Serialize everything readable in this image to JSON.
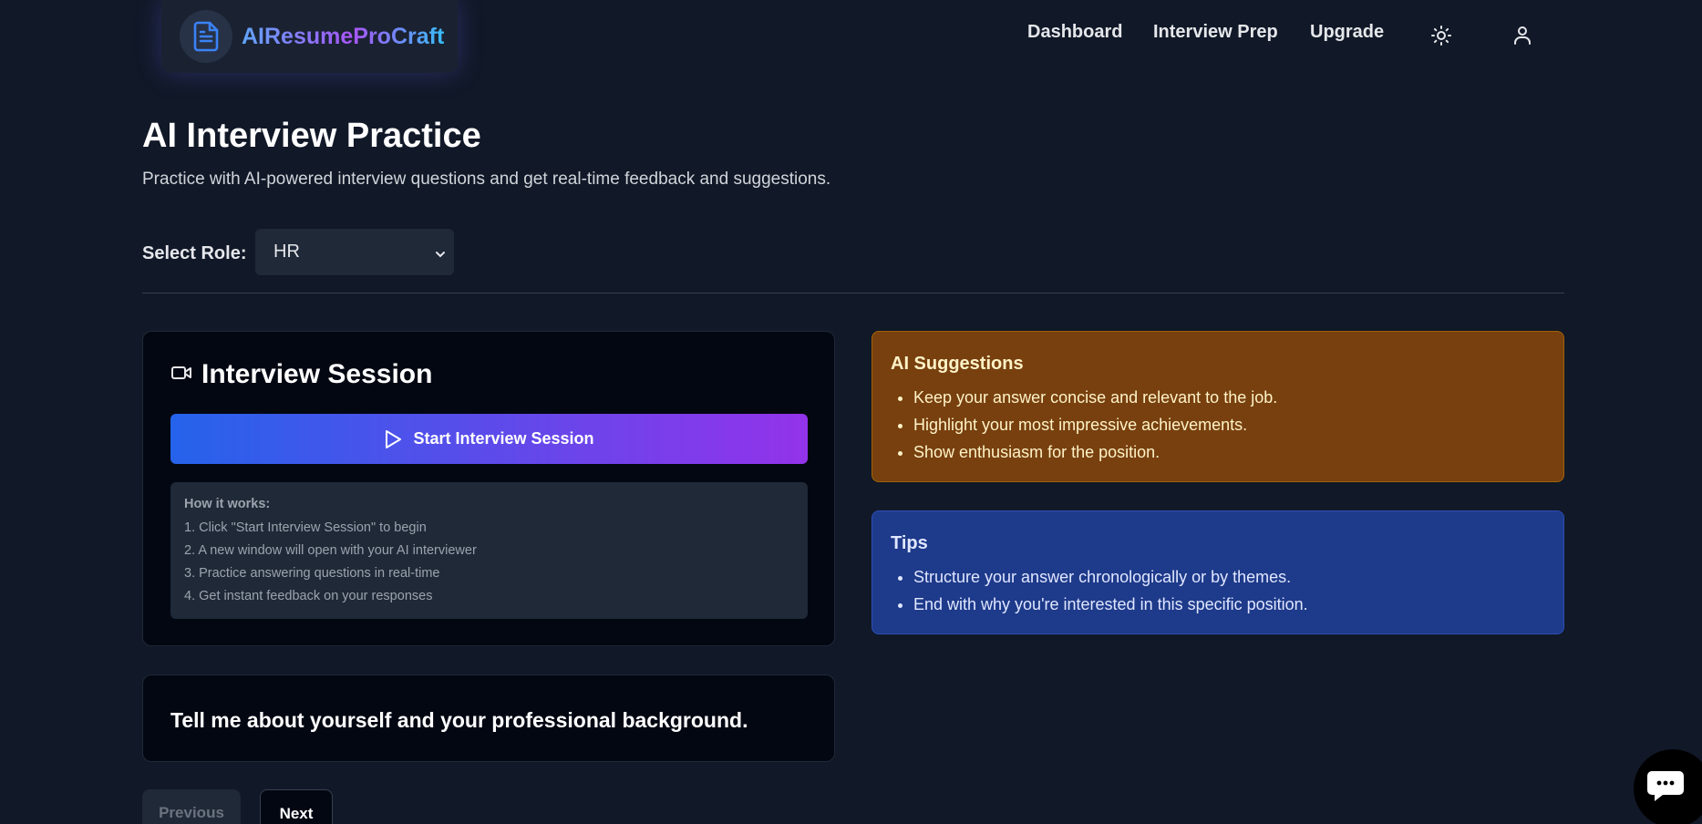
{
  "brand": {
    "name": "AIResumeProCraft",
    "icon": "document-icon"
  },
  "nav": {
    "links": [
      "Dashboard",
      "Interview Prep",
      "Upgrade"
    ],
    "theme_icon": "sun-icon",
    "user_icon": "user-icon"
  },
  "page": {
    "title": "AI Interview Practice",
    "subtitle": "Practice with AI-powered interview questions and get real-time feedback and suggestions."
  },
  "role": {
    "label": "Select Role:",
    "value": "HR",
    "icon": "chevron-down-icon"
  },
  "session": {
    "title": "Interview Session",
    "icon": "video-camera-icon",
    "start_label": "Start Interview Session",
    "start_icon": "play-icon",
    "how_title": "How it works:",
    "steps": [
      "1. Click \"Start Interview Session\" to begin",
      "2. A new window will open with your AI interviewer",
      "3. Practice answering questions in real-time",
      "4. Get instant feedback on your responses"
    ]
  },
  "question": "Tell me about yourself and your professional background.",
  "pagination": {
    "prev_label": "Previous",
    "next_label": "Next"
  },
  "ai_suggestions": {
    "title": "AI Suggestions",
    "items": [
      "Keep your answer concise and relevant to the job.",
      "Highlight your most impressive achievements.",
      "Show enthusiasm for the position."
    ]
  },
  "tips": {
    "title": "Tips",
    "items": [
      "Structure your answer chronologically or by themes.",
      "End with why you're interested in this specific position."
    ]
  },
  "chat": {
    "icon": "chat-bubble-icon"
  },
  "colors": {
    "background": "#111827",
    "accent_start": "#2563eb",
    "accent_end": "#9333ea",
    "suggestions_bg": "#78400f",
    "tips_bg": "#1e3a8a"
  }
}
